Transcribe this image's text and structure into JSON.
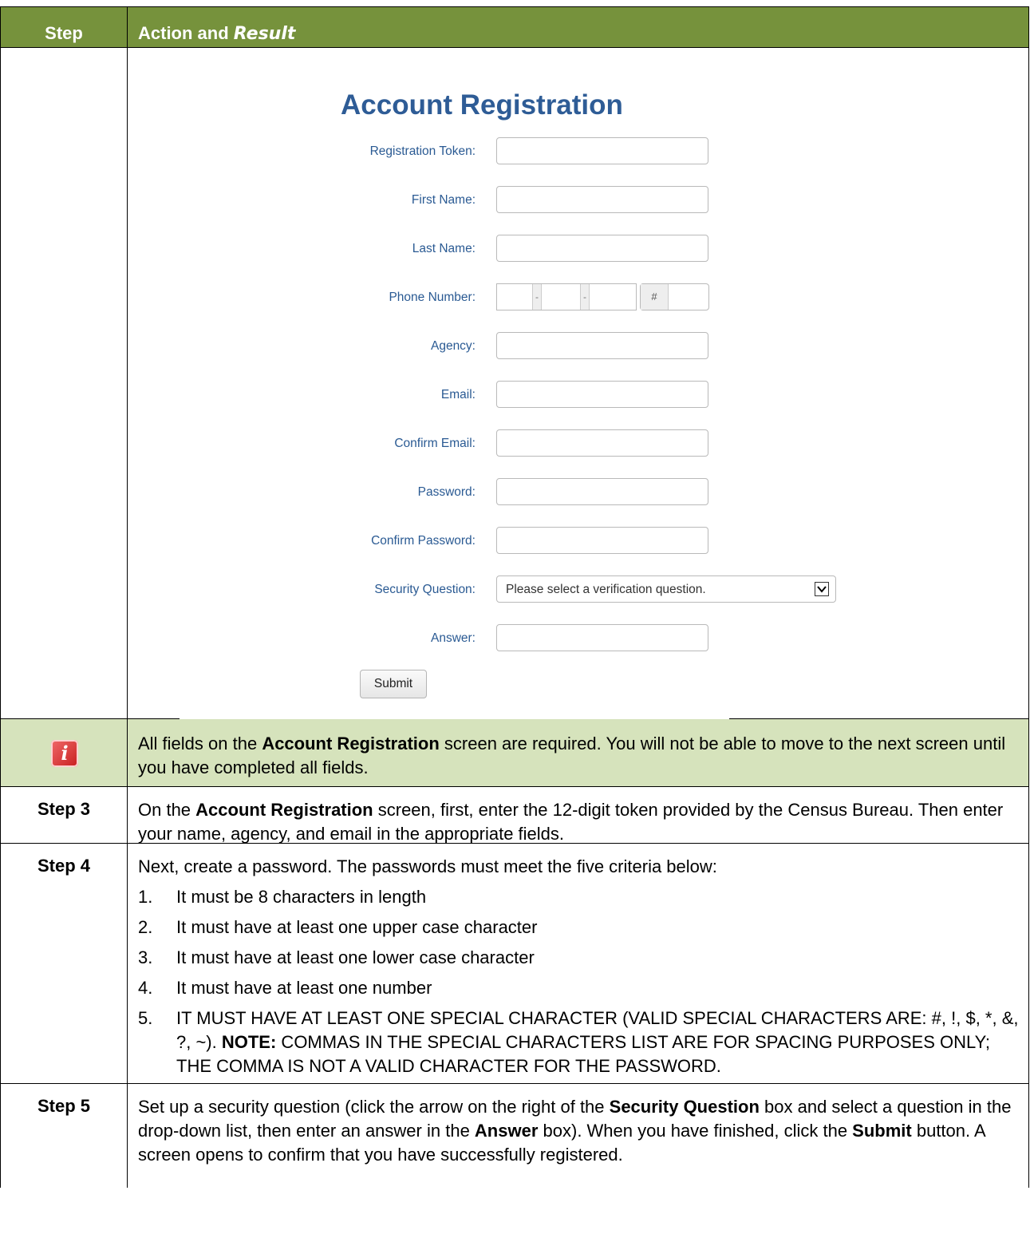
{
  "header": {
    "step": "Step",
    "action": "Action and",
    "result": "Result"
  },
  "form": {
    "title": "Account Registration",
    "labels": {
      "token": "Registration Token:",
      "first_name": "First Name:",
      "last_name": "Last Name:",
      "phone": "Phone Number:",
      "agency": "Agency:",
      "email": "Email:",
      "confirm_email": "Confirm Email:",
      "password": "Password:",
      "confirm_password": "Confirm Password:",
      "security_question": "Security Question:",
      "answer": "Answer:"
    },
    "phone_sep": "-",
    "phone_ext": "#",
    "security_placeholder": "Please select a verification question.",
    "submit": "Submit"
  },
  "note": {
    "icon": "info-icon",
    "p1": "All fields on the ",
    "b1": "Account Registration",
    "p2": " screen are required. You will not be able to move to the next screen until you have completed all fields."
  },
  "step3": {
    "label": "Step 3",
    "p1": "On the ",
    "b1": "Account Registration",
    "p2": " screen, first, enter the 12-digit token provided by the Census Bureau. Then enter your name, agency, and email in the appropriate fields."
  },
  "step4": {
    "label": "Step 4",
    "intro": "Next, create a password. The passwords must meet the five criteria below:",
    "items": [
      {
        "num": "1.",
        "text": "It must be 8 characters in length"
      },
      {
        "num": "2.",
        "text": "It must have at least one upper case character"
      },
      {
        "num": "3.",
        "text": "It must have at least one lower case character"
      },
      {
        "num": "4.",
        "text": "It must have at least one number"
      }
    ],
    "item5_num": "5.",
    "item5_p1": "IT MUST HAVE AT LEAST ONE SPECIAL CHARACTER (VALID SPECIAL CHARACTERS ARE: #, !, $, *, &, ?, ~). ",
    "item5_b1": "NOTE:",
    "item5_p2": "  COMMAS IN THE SPECIAL CHARACTERS LIST ARE FOR SPACING PURPOSES ONLY; THE COMMA IS NOT A VALID CHARACTER FOR THE PASSWORD."
  },
  "step5": {
    "label": "Step 5",
    "p1": "Set up a security question (click the arrow on the right of the ",
    "b1": "Security Question",
    "p2": " box and select a question in the drop-down list, then enter an answer in the ",
    "b2": "Answer",
    "p3": " box). When you have finished, click the ",
    "b3": "Submit",
    "p4": " button. A screen opens to confirm that you have successfully registered."
  }
}
